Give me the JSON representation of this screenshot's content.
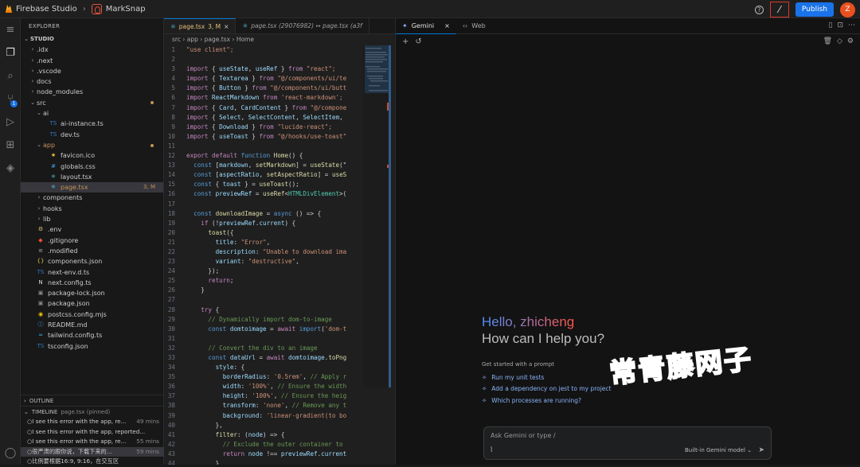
{
  "topbar": {
    "app_name": "Firebase Studio",
    "project": "MarkSnap",
    "publish_label": "Publish",
    "help_icon": "help-circle-icon",
    "wand_icon": "magic-wand-icon",
    "avatar_letter": "Z",
    "colors": {
      "publish": "#1a73e8",
      "avatar": "#e8511f",
      "highlight": "#d73a2a"
    }
  },
  "explorer": {
    "title": "EXPLORER",
    "root": "STUDIO",
    "items": [
      {
        "label": ".idx",
        "depth": 1,
        "type": "folder",
        "open": false
      },
      {
        "label": ".next",
        "depth": 1,
        "type": "folder",
        "open": false
      },
      {
        "label": ".vscode",
        "depth": 1,
        "type": "folder",
        "open": false
      },
      {
        "label": "docs",
        "depth": 1,
        "type": "folder",
        "open": false
      },
      {
        "label": "node_modules",
        "depth": 1,
        "type": "folder",
        "open": false
      },
      {
        "label": "src",
        "depth": 1,
        "type": "folder",
        "open": true,
        "git": "dot"
      },
      {
        "label": "ai",
        "depth": 2,
        "type": "folder",
        "open": true
      },
      {
        "label": "ai-instance.ts",
        "depth": 3,
        "type": "ts"
      },
      {
        "label": "dev.ts",
        "depth": 3,
        "type": "ts"
      },
      {
        "label": "app",
        "depth": 2,
        "type": "folder",
        "open": true,
        "git": "dot",
        "color": "#c6925a"
      },
      {
        "label": "favicon.ico",
        "depth": 3,
        "type": "ico"
      },
      {
        "label": "globals.css",
        "depth": 3,
        "type": "css"
      },
      {
        "label": "layout.tsx",
        "depth": 3,
        "type": "tsx"
      },
      {
        "label": "page.tsx",
        "depth": 3,
        "type": "tsx",
        "selected": true,
        "git": "3, M",
        "color": "#c6925a"
      },
      {
        "label": "components",
        "depth": 2,
        "type": "folder",
        "open": false
      },
      {
        "label": "hooks",
        "depth": 2,
        "type": "folder",
        "open": false
      },
      {
        "label": "lib",
        "depth": 2,
        "type": "folder",
        "open": false
      },
      {
        "label": ".env",
        "depth": 1,
        "type": "env"
      },
      {
        "label": ".gitignore",
        "depth": 1,
        "type": "git"
      },
      {
        "label": ".modified",
        "depth": 1,
        "type": "txt"
      },
      {
        "label": "components.json",
        "depth": 1,
        "type": "json"
      },
      {
        "label": "next-env.d.ts",
        "depth": 1,
        "type": "ts"
      },
      {
        "label": "next.config.ts",
        "depth": 1,
        "type": "next"
      },
      {
        "label": "package-lock.json",
        "depth": 1,
        "type": "npm"
      },
      {
        "label": "package.json",
        "depth": 1,
        "type": "npm"
      },
      {
        "label": "postcss.config.mjs",
        "depth": 1,
        "type": "js"
      },
      {
        "label": "README.md",
        "depth": 1,
        "type": "md"
      },
      {
        "label": "tailwind.config.ts",
        "depth": 1,
        "type": "tw"
      },
      {
        "label": "tsconfig.json",
        "depth": 1,
        "type": "ts"
      }
    ],
    "outline_label": "OUTLINE",
    "timeline_label": "TIMELINE",
    "timeline_pinned": "page.tsx (pinned)",
    "timeline": [
      {
        "text": "I see this error with the app, re...",
        "time": "49 mins"
      },
      {
        "text": "I see this error with the app, reported...",
        "time": ""
      },
      {
        "text": "I see this error with the app, re...",
        "time": "55 mins"
      },
      {
        "text": "很严肃的跟你说，下载下来的...",
        "time": "59 mins"
      },
      {
        "text": "比例要根据16:9, 9:16，在交互区",
        "time": ""
      }
    ]
  },
  "editor": {
    "tabs": [
      {
        "label": "page.tsx",
        "badge": "3, M",
        "active": true
      },
      {
        "label": "page.tsx (29076982) ↔ page.tsx (a3f",
        "badge": "",
        "active": false
      }
    ],
    "breadcrumb": [
      "src",
      "app",
      "page.tsx",
      "Home"
    ],
    "start_line": 1,
    "lines": [
      [
        [
          "st",
          "\"use client\";"
        ]
      ],
      [],
      [
        [
          "kw",
          "import"
        ],
        [
          "ct",
          " { "
        ],
        [
          "vr",
          "useState"
        ],
        [
          "ct",
          ", "
        ],
        [
          "vr",
          "useRef"
        ],
        [
          "ct",
          " } "
        ],
        [
          "kw",
          "from"
        ],
        [
          "st",
          " \"react\";"
        ]
      ],
      [
        [
          "kw",
          "import"
        ],
        [
          "ct",
          " { "
        ],
        [
          "vr",
          "Textarea"
        ],
        [
          "ct",
          " } "
        ],
        [
          "kw",
          "from"
        ],
        [
          "st",
          " \"@/components/ui/te"
        ]
      ],
      [
        [
          "kw",
          "import"
        ],
        [
          "ct",
          " { "
        ],
        [
          "vr",
          "Button"
        ],
        [
          "ct",
          " } "
        ],
        [
          "kw",
          "from"
        ],
        [
          "st",
          " \"@/components/ui/butt"
        ]
      ],
      [
        [
          "kw",
          "import"
        ],
        [
          "vr",
          " ReactMarkdown"
        ],
        [
          "kw",
          " from"
        ],
        [
          "st",
          " 'react-markdown';"
        ]
      ],
      [
        [
          "kw",
          "import"
        ],
        [
          "ct",
          " { "
        ],
        [
          "vr",
          "Card"
        ],
        [
          "ct",
          ", "
        ],
        [
          "vr",
          "CardContent"
        ],
        [
          "ct",
          " } "
        ],
        [
          "kw",
          "from"
        ],
        [
          "st",
          " \"@/compone"
        ]
      ],
      [
        [
          "kw",
          "import"
        ],
        [
          "ct",
          " { "
        ],
        [
          "vr",
          "Select"
        ],
        [
          "ct",
          ", "
        ],
        [
          "vr",
          "SelectContent"
        ],
        [
          "ct",
          ", "
        ],
        [
          "vr",
          "SelectItem"
        ],
        [
          "ct",
          ","
        ]
      ],
      [
        [
          "kw",
          "import"
        ],
        [
          "ct",
          " { "
        ],
        [
          "vr",
          "Download"
        ],
        [
          "ct",
          " } "
        ],
        [
          "kw",
          "from"
        ],
        [
          "st",
          " \"lucide-react\";"
        ]
      ],
      [
        [
          "kw",
          "import"
        ],
        [
          "ct",
          " { "
        ],
        [
          "vr",
          "useToast"
        ],
        [
          "ct",
          " } "
        ],
        [
          "kw",
          "from"
        ],
        [
          "st",
          " \"@/hooks/use-toast\""
        ]
      ],
      [],
      [
        [
          "kw",
          "export default"
        ],
        [
          "kb",
          " function"
        ],
        [
          "fn",
          " Home"
        ],
        [
          "ct",
          "() {"
        ]
      ],
      [
        [
          "kb",
          "  const"
        ],
        [
          "ct",
          " ["
        ],
        [
          "vr",
          "markdown"
        ],
        [
          "ct",
          ", "
        ],
        [
          "fn",
          "setMarkdown"
        ],
        [
          "ct",
          "] = "
        ],
        [
          "fn",
          "useState"
        ],
        [
          "ct",
          "(\""
        ]
      ],
      [
        [
          "kb",
          "  const"
        ],
        [
          "ct",
          " ["
        ],
        [
          "vr",
          "aspectRatio"
        ],
        [
          "ct",
          ", "
        ],
        [
          "fn",
          "setAspectRatio"
        ],
        [
          "ct",
          "] = "
        ],
        [
          "fn",
          "useS"
        ]
      ],
      [
        [
          "kb",
          "  const"
        ],
        [
          "ct",
          " { "
        ],
        [
          "vr",
          "toast"
        ],
        [
          "ct",
          " } = "
        ],
        [
          "fn",
          "useToast"
        ],
        [
          "ct",
          "();"
        ]
      ],
      [
        [
          "kb",
          "  const"
        ],
        [
          "vr",
          " previewRef"
        ],
        [
          "ct",
          " = "
        ],
        [
          "fn",
          "useRef"
        ],
        [
          "ct",
          "<"
        ],
        [
          "ty",
          "HTMLDivElement"
        ],
        [
          "ct",
          ">("
        ]
      ],
      [],
      [
        [
          "kb",
          "  const"
        ],
        [
          "fn",
          " downloadImage"
        ],
        [
          "ct",
          " = "
        ],
        [
          "kb",
          "async"
        ],
        [
          "ct",
          " () => {"
        ]
      ],
      [
        [
          "kw",
          "    if"
        ],
        [
          "ct",
          " (!"
        ],
        [
          "vr",
          "previewRef"
        ],
        [
          "ct",
          "."
        ],
        [
          "vr",
          "current"
        ],
        [
          "ct",
          ") {"
        ]
      ],
      [
        [
          "fn",
          "      toast"
        ],
        [
          "ct",
          "({"
        ]
      ],
      [
        [
          "vr",
          "        title"
        ],
        [
          "ct",
          ": "
        ],
        [
          "st",
          "\"Error\""
        ],
        [
          "ct",
          ","
        ]
      ],
      [
        [
          "vr",
          "        description"
        ],
        [
          "ct",
          ": "
        ],
        [
          "st",
          "\"Unable to download ima"
        ]
      ],
      [
        [
          "vr",
          "        variant"
        ],
        [
          "ct",
          ": "
        ],
        [
          "st",
          "\"destructive\""
        ],
        [
          "ct",
          ","
        ]
      ],
      [
        [
          "ct",
          "      });"
        ]
      ],
      [
        [
          "kw",
          "      return"
        ],
        [
          "ct",
          ";"
        ]
      ],
      [
        [
          "ct",
          "    }"
        ]
      ],
      [],
      [
        [
          "kw",
          "    try"
        ],
        [
          "ct",
          " {"
        ]
      ],
      [
        [
          "cm",
          "      // Dynamically import dom-to-image"
        ]
      ],
      [
        [
          "kb",
          "      const"
        ],
        [
          "vr",
          " domtoimage"
        ],
        [
          "ct",
          " = "
        ],
        [
          "kw",
          "await"
        ],
        [
          "kb",
          " import"
        ],
        [
          "ct",
          "("
        ],
        [
          "st",
          "'dom-t"
        ]
      ],
      [],
      [
        [
          "cm",
          "      // Convert the div to an image"
        ]
      ],
      [
        [
          "kb",
          "      const"
        ],
        [
          "vr",
          " dataUrl"
        ],
        [
          "ct",
          " = "
        ],
        [
          "kw",
          "await"
        ],
        [
          "vr",
          " domtoimage"
        ],
        [
          "ct",
          "."
        ],
        [
          "fn",
          "toPng"
        ]
      ],
      [
        [
          "vr",
          "        style"
        ],
        [
          "ct",
          ": {"
        ]
      ],
      [
        [
          "vr",
          "          borderRadius"
        ],
        [
          "ct",
          ": "
        ],
        [
          "st",
          "'0.5rem'"
        ],
        [
          "ct",
          ", "
        ],
        [
          "cm",
          "// Apply r"
        ]
      ],
      [
        [
          "vr",
          "          width"
        ],
        [
          "ct",
          ": "
        ],
        [
          "st",
          "'100%'"
        ],
        [
          "ct",
          ", "
        ],
        [
          "cm",
          "// Ensure the width"
        ]
      ],
      [
        [
          "vr",
          "          height"
        ],
        [
          "ct",
          ": "
        ],
        [
          "st",
          "'100%'"
        ],
        [
          "ct",
          ", "
        ],
        [
          "cm",
          "// Ensure the heig"
        ]
      ],
      [
        [
          "vr",
          "          transform"
        ],
        [
          "ct",
          ": "
        ],
        [
          "st",
          "'none'"
        ],
        [
          "ct",
          ", "
        ],
        [
          "cm",
          "// Remove any t"
        ]
      ],
      [
        [
          "vr",
          "          background"
        ],
        [
          "ct",
          ": "
        ],
        [
          "st",
          "'linear-gradient(to bo"
        ]
      ],
      [
        [
          "ct",
          "        },"
        ]
      ],
      [
        [
          "fn",
          "        filter"
        ],
        [
          "ct",
          ": ("
        ],
        [
          "vr",
          "node"
        ],
        [
          "ct",
          ") => {"
        ]
      ],
      [
        [
          "cm",
          "          // Exclude the outer container to"
        ]
      ],
      [
        [
          "kw",
          "          return"
        ],
        [
          "vr",
          " node"
        ],
        [
          "ct",
          " !== "
        ],
        [
          "vr",
          "previewRef"
        ],
        [
          "ct",
          "."
        ],
        [
          "vr",
          "current"
        ]
      ],
      [
        [
          "ct",
          "        }"
        ]
      ]
    ]
  },
  "gemini": {
    "tabs": [
      {
        "label": "Gemini",
        "active": true,
        "icon": "gemini-sparkle-icon"
      },
      {
        "label": "Web",
        "active": false,
        "icon": "code-icon"
      }
    ],
    "greeting": "Hello, zhicheng",
    "subtitle": "How can I help you?",
    "get_started": "Get started with a prompt",
    "suggestions": [
      "Run my unit tests",
      "Add a dependency on jest to my project",
      "Which processes are running?"
    ],
    "prompt_placeholder": "Ask Gemini or type /",
    "model_label": "Built-in Gemini model",
    "watermark": "常青藤网子"
  }
}
